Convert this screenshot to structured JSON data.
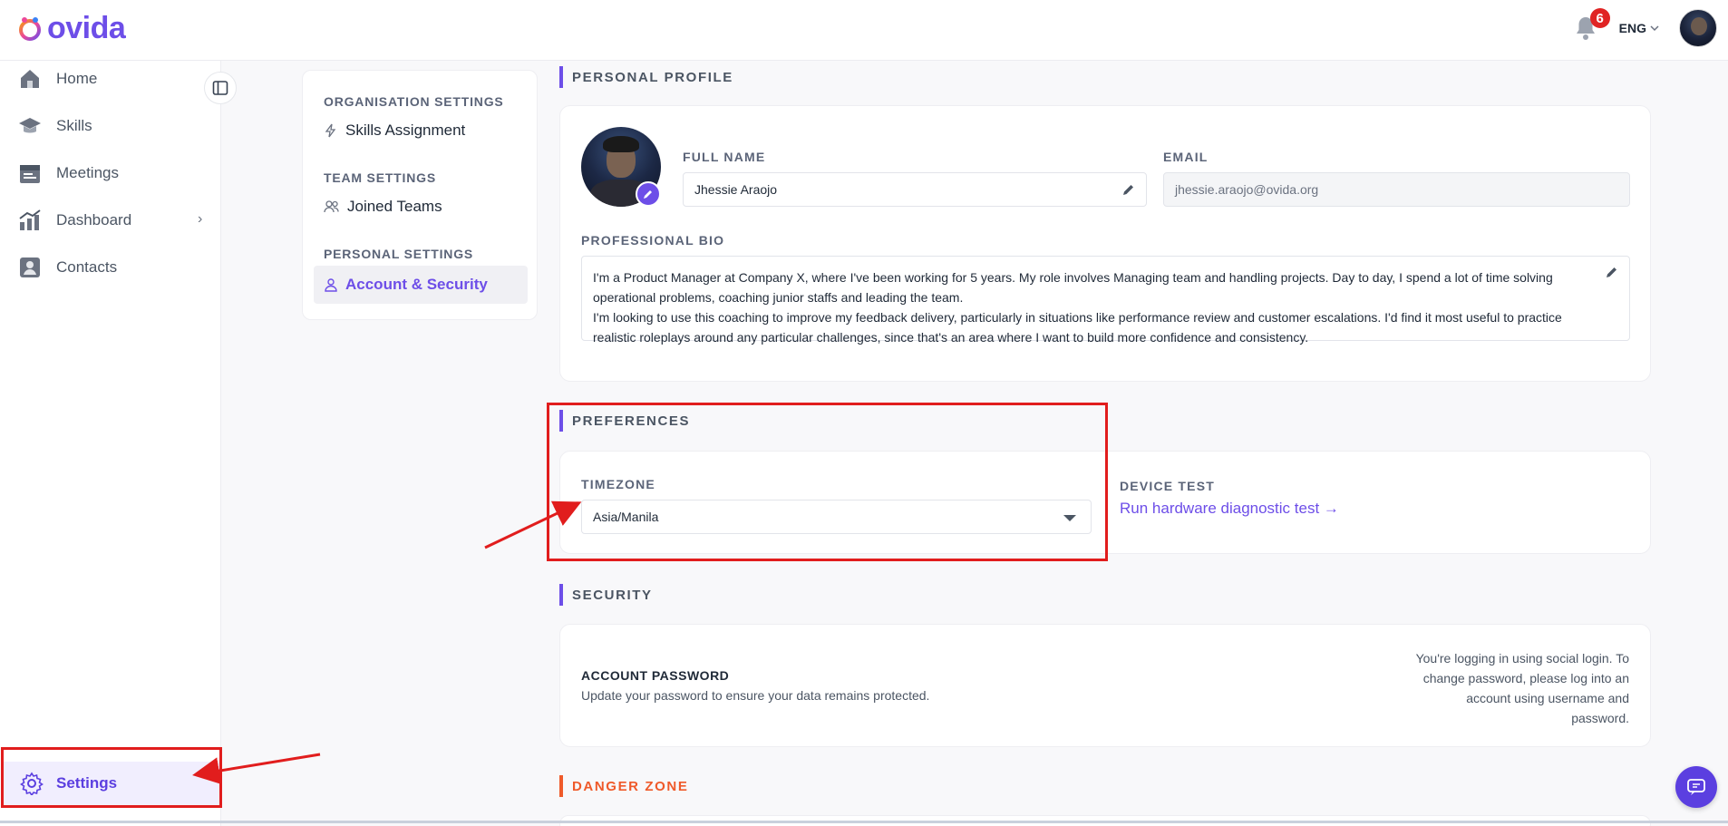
{
  "app": {
    "logo_text": "ovida",
    "brand_color": "#6d4ee8"
  },
  "header": {
    "notification_count": "6",
    "language": "ENG",
    "avatar_icon": "user-avatar"
  },
  "sidebar": {
    "items": [
      {
        "label": "Home",
        "icon": "home-icon"
      },
      {
        "label": "Skills",
        "icon": "graduation-cap-icon"
      },
      {
        "label": "Meetings",
        "icon": "calendar-icon"
      },
      {
        "label": "Dashboard",
        "icon": "chart-icon",
        "has_submenu": true
      },
      {
        "label": "Contacts",
        "icon": "contact-card-icon"
      }
    ],
    "settings_label": "Settings"
  },
  "settings_nav": {
    "org_section": "ORGANISATION SETTINGS",
    "skills_assignment": "Skills Assignment",
    "team_section": "TEAM SETTINGS",
    "joined_teams": "Joined Teams",
    "personal_section": "PERSONAL SETTINGS",
    "account_security": "Account & Security"
  },
  "profile": {
    "section_title": "PERSONAL PROFILE",
    "full_name_label": "FULL NAME",
    "full_name": "Jhessie Araojo",
    "email_label": "EMAIL",
    "email": "jhessie.araojo@ovida.org",
    "bio_label": "PROFESSIONAL BIO",
    "bio_line1": "I'm a Product Manager at Company X, where I've been working for 5 years. My role involves Managing team and handling projects. Day to day, I spend a lot of time solving operational problems, coaching junior staffs and leading the team.",
    "bio_line2": "I'm looking to use this coaching to improve my feedback delivery, particularly in situations like performance review and customer escalations. I'd find it most useful to practice realistic roleplays around any particular challenges, since that's an area where I want to build more confidence and consistency."
  },
  "preferences": {
    "section_title": "PREFERENCES",
    "timezone_label": "TIMEZONE",
    "timezone_value": "Asia/Manila",
    "device_test_label": "DEVICE TEST",
    "device_test_link": "Run hardware diagnostic test →"
  },
  "security": {
    "section_title": "SECURITY",
    "password_title": "ACCOUNT PASSWORD",
    "password_subtitle": "Update your password to ensure your data remains protected.",
    "social_note": "You're logging in using social login. To change password, please log into an account using username and password."
  },
  "danger": {
    "section_title": "DANGER ZONE"
  },
  "annotation_color": "#e11d1d"
}
